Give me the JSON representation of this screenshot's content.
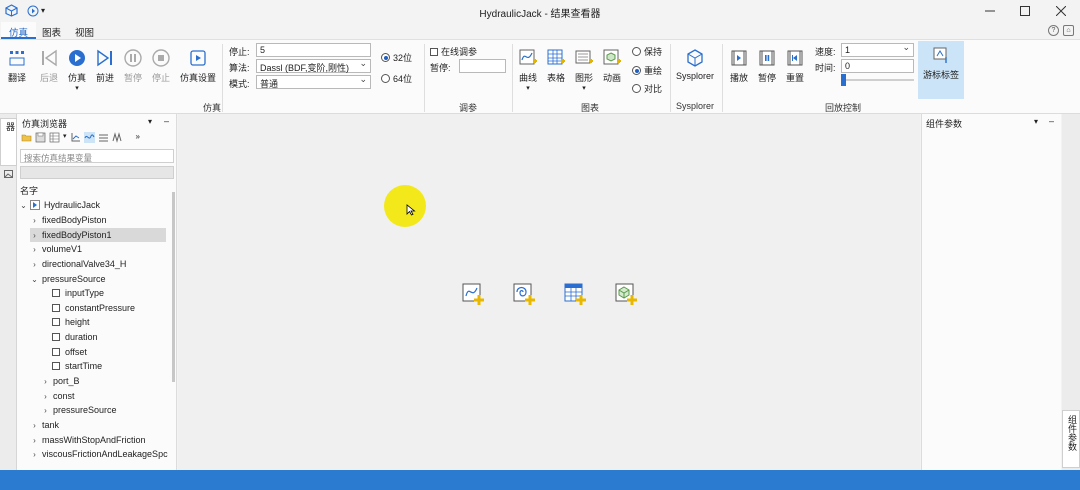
{
  "window": {
    "title": "HydraulicJack - 结果查看器"
  },
  "menu": {
    "tabs": [
      "仿真",
      "图表",
      "视图"
    ],
    "active": 0
  },
  "ribbon": {
    "sim_buttons": [
      "翻译",
      "后退",
      "仿真",
      "前进",
      "暂停",
      "停止",
      "仿真设置"
    ],
    "stop_label": "停止:",
    "stop_value": "5",
    "algo_label": "算法:",
    "algo_value": "Dassl (BDF,变阶,刚性)",
    "mode_label": "模式:",
    "mode_value": "普通",
    "bit32": "32位",
    "bit64": "64位",
    "sim_group": "仿真",
    "online_tune": "在线调参",
    "pause_label": "暂停:",
    "tune_group": "调参",
    "chart_buttons": [
      "曲线",
      "表格",
      "图形",
      "动画"
    ],
    "keep": "保持",
    "redraw": "重绘",
    "compare": "对比",
    "chart_group": "图表",
    "sysplorer_btn": "Sysplorer",
    "sysplorer_group": "Sysplorer",
    "play": "播放",
    "pause": "暂停",
    "reset": "重置",
    "speed_label": "速度:",
    "speed_value": "1",
    "time_label": "时间:",
    "time_value": "0",
    "cursor_label": "游标标签",
    "playback_group": "回放控制"
  },
  "left_tab": "仿真浏览器",
  "browser": {
    "title": "仿真浏览器",
    "search_placeholder": "搜索仿真结果变量",
    "col_name": "名字",
    "rows": [
      {
        "label": "HydraulicJack",
        "arrow": "⌄"
      },
      {
        "label": "fixedBodyPiston",
        "arrow": "›"
      },
      {
        "label": "fixedBodyPiston1",
        "arrow": "›"
      },
      {
        "label": "volumeV1",
        "arrow": "›"
      },
      {
        "label": "directionalValve34_H",
        "arrow": "›"
      },
      {
        "label": "pressureSource",
        "arrow": "⌄"
      },
      {
        "label": "inputType",
        "arrow": ""
      },
      {
        "label": "constantPressure",
        "arrow": ""
      },
      {
        "label": "height",
        "arrow": ""
      },
      {
        "label": "duration",
        "arrow": ""
      },
      {
        "label": "offset",
        "arrow": ""
      },
      {
        "label": "startTime",
        "arrow": ""
      },
      {
        "label": "port_B",
        "arrow": "›"
      },
      {
        "label": "const",
        "arrow": "›"
      },
      {
        "label": "pressureSource",
        "arrow": "›"
      },
      {
        "label": "tank",
        "arrow": "›"
      },
      {
        "label": "massWithStopAndFriction",
        "arrow": "›"
      },
      {
        "label": "viscousFrictionAndLeakageSpc",
        "arrow": "›"
      }
    ]
  },
  "right_panel": {
    "title": "组件参数",
    "tab": "组件参数"
  }
}
